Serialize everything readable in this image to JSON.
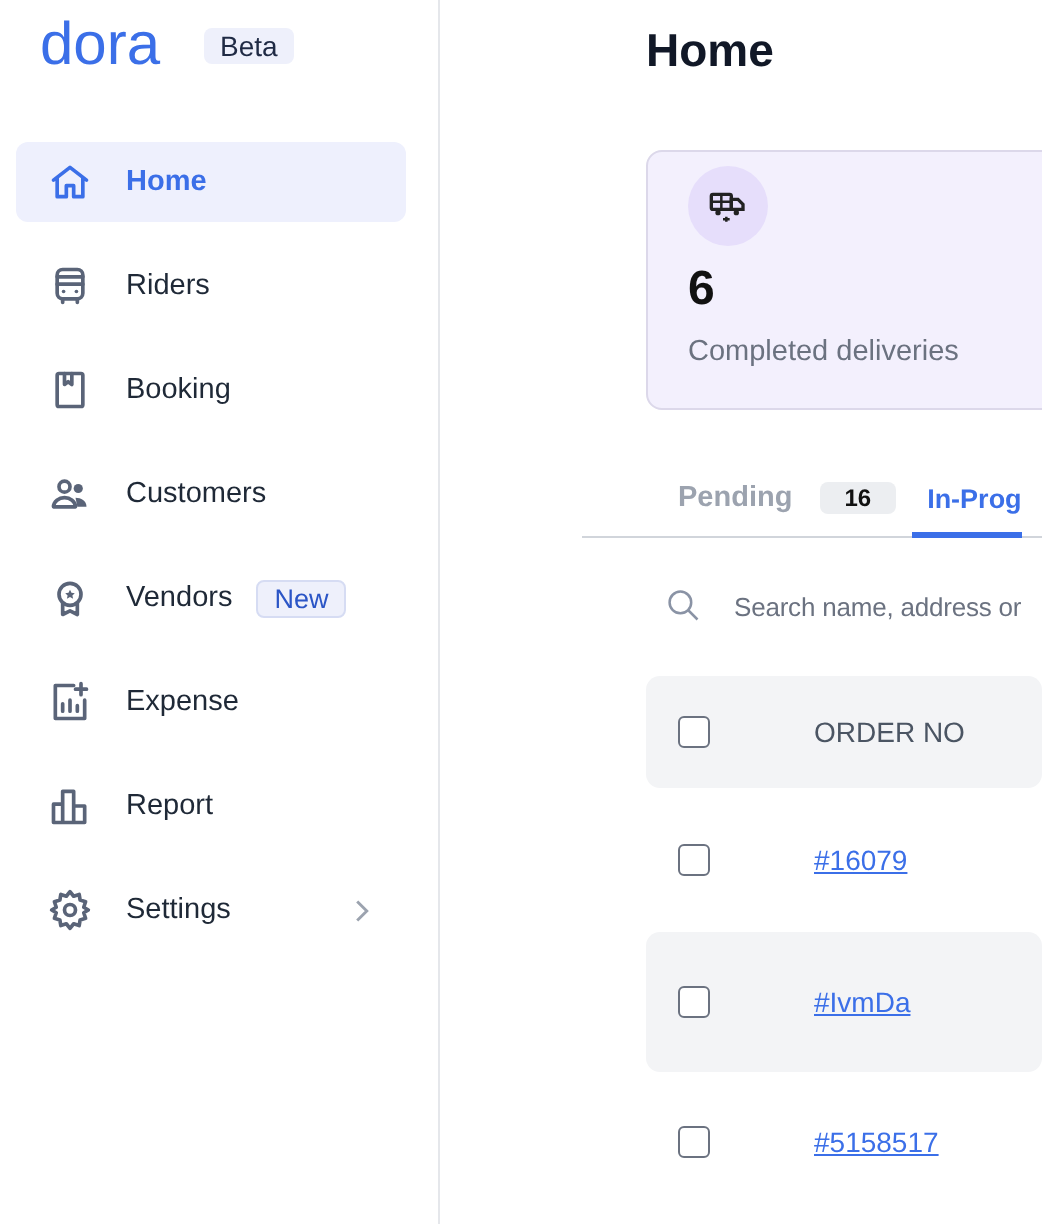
{
  "sidebar": {
    "logo": "dora",
    "badge": "Beta",
    "items": [
      {
        "label": "Home",
        "selected": true
      },
      {
        "label": "Riders",
        "selected": false
      },
      {
        "label": "Booking",
        "selected": false
      },
      {
        "label": "Customers",
        "selected": false
      },
      {
        "label": "Vendors",
        "selected": false,
        "badge": "New"
      },
      {
        "label": "Expense",
        "selected": false
      },
      {
        "label": "Report",
        "selected": false
      },
      {
        "label": "Settings",
        "selected": false,
        "has_submenu": true
      }
    ]
  },
  "page": {
    "title": "Home"
  },
  "stat_card": {
    "value": "6",
    "label": "Completed deliveries"
  },
  "tabs": [
    {
      "label": "Pending",
      "count": "16",
      "selected": false
    },
    {
      "label": "In-Prog",
      "selected": true
    }
  ],
  "search": {
    "placeholder": "Search name, address or"
  },
  "table": {
    "header_checked": false,
    "columns": [
      "ORDER NO"
    ],
    "rows": [
      {
        "order_no": "#16079",
        "checked": false
      },
      {
        "order_no": "#IvmDa",
        "checked": false
      },
      {
        "order_no": "#5158517",
        "checked": false
      }
    ]
  }
}
